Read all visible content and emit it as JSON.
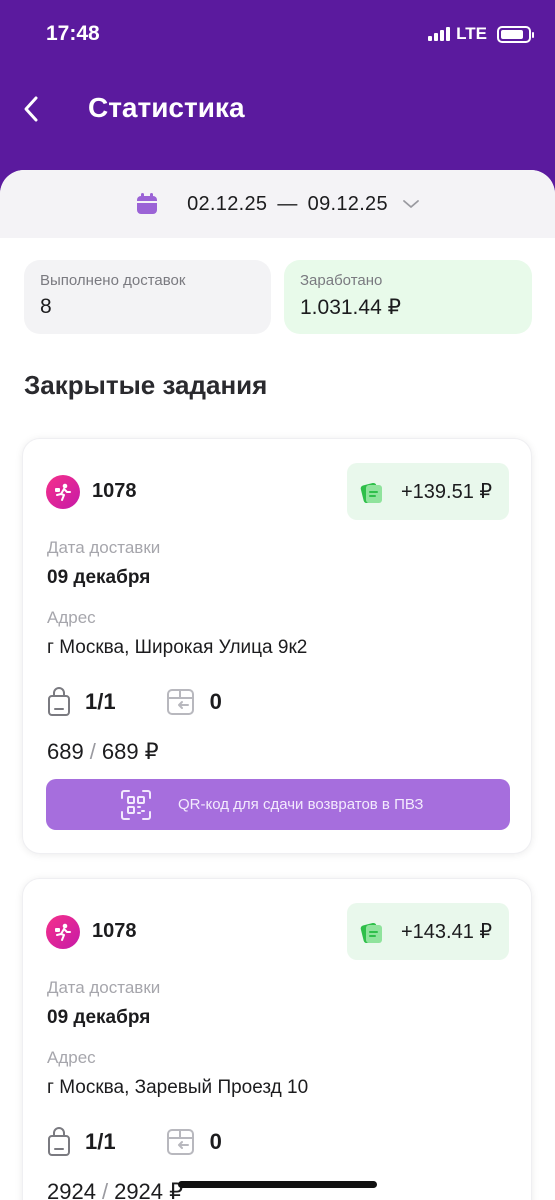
{
  "status_bar": {
    "time": "17:48",
    "network": "LTE"
  },
  "header": {
    "title": "Статистика"
  },
  "date_range": {
    "from": "02.12.25",
    "separator": "—",
    "to": "09.12.25"
  },
  "stats": [
    {
      "label": "Выполнено доставок",
      "value": "8"
    },
    {
      "label": "Заработано",
      "value": "1.031.44 ₽"
    }
  ],
  "section_title": "Закрытые задания",
  "orders": [
    {
      "number": "1078",
      "earned": "+139.51 ₽",
      "date_label": "Дата доставки",
      "date": "09 декабря",
      "address_label": "Адрес",
      "address": "г Москва, Широкая Улица 9к2",
      "items": "1/1",
      "returns": "0",
      "price_paid": "689",
      "price_total": "689 ₽",
      "qr_button": "QR-код для сдачи возвратов в ПВЗ"
    },
    {
      "number": "1078",
      "earned": "+143.41 ₽",
      "date_label": "Дата доставки",
      "date": "09 декабря",
      "address_label": "Адрес",
      "address": "г Москва, Заревый Проезд 10",
      "items": "1/1",
      "returns": "0",
      "price_paid": "2924",
      "price_total": "2924 ₽"
    }
  ],
  "colors": {
    "header": "#5b1a9e",
    "accent": "#a66edd",
    "earn_bg": "#e9f8ec",
    "order_icon": "#e02a97"
  },
  "icons": [
    "back-icon",
    "calendar-icon",
    "chevron-down-icon",
    "courier-icon",
    "money-icon",
    "bag-icon",
    "return-box-icon",
    "qr-code-icon"
  ]
}
